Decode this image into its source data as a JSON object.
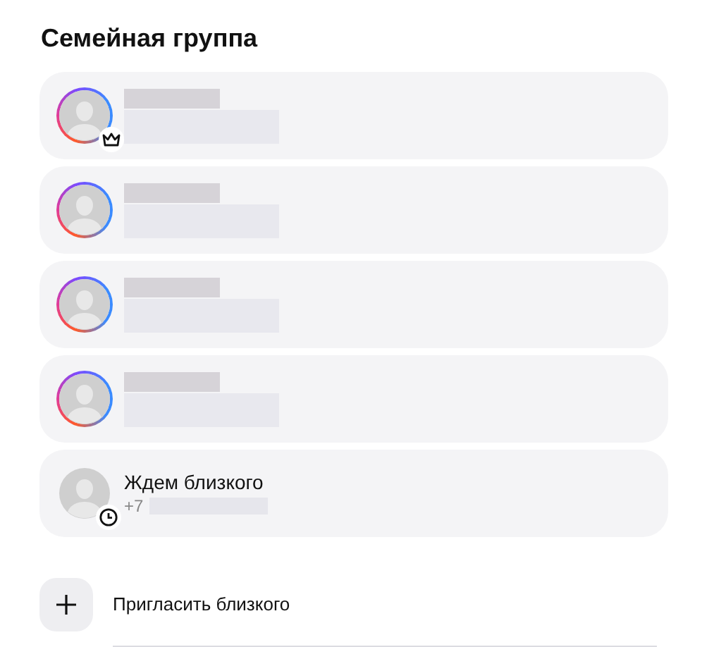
{
  "title": "Семейная группа",
  "members": [
    {
      "kind": "owner"
    },
    {
      "kind": "member"
    },
    {
      "kind": "member"
    },
    {
      "kind": "member"
    },
    {
      "kind": "pending",
      "name": "Ждем близкого",
      "phone": "+7"
    }
  ],
  "invite": {
    "label": "Пригласить близкого"
  }
}
